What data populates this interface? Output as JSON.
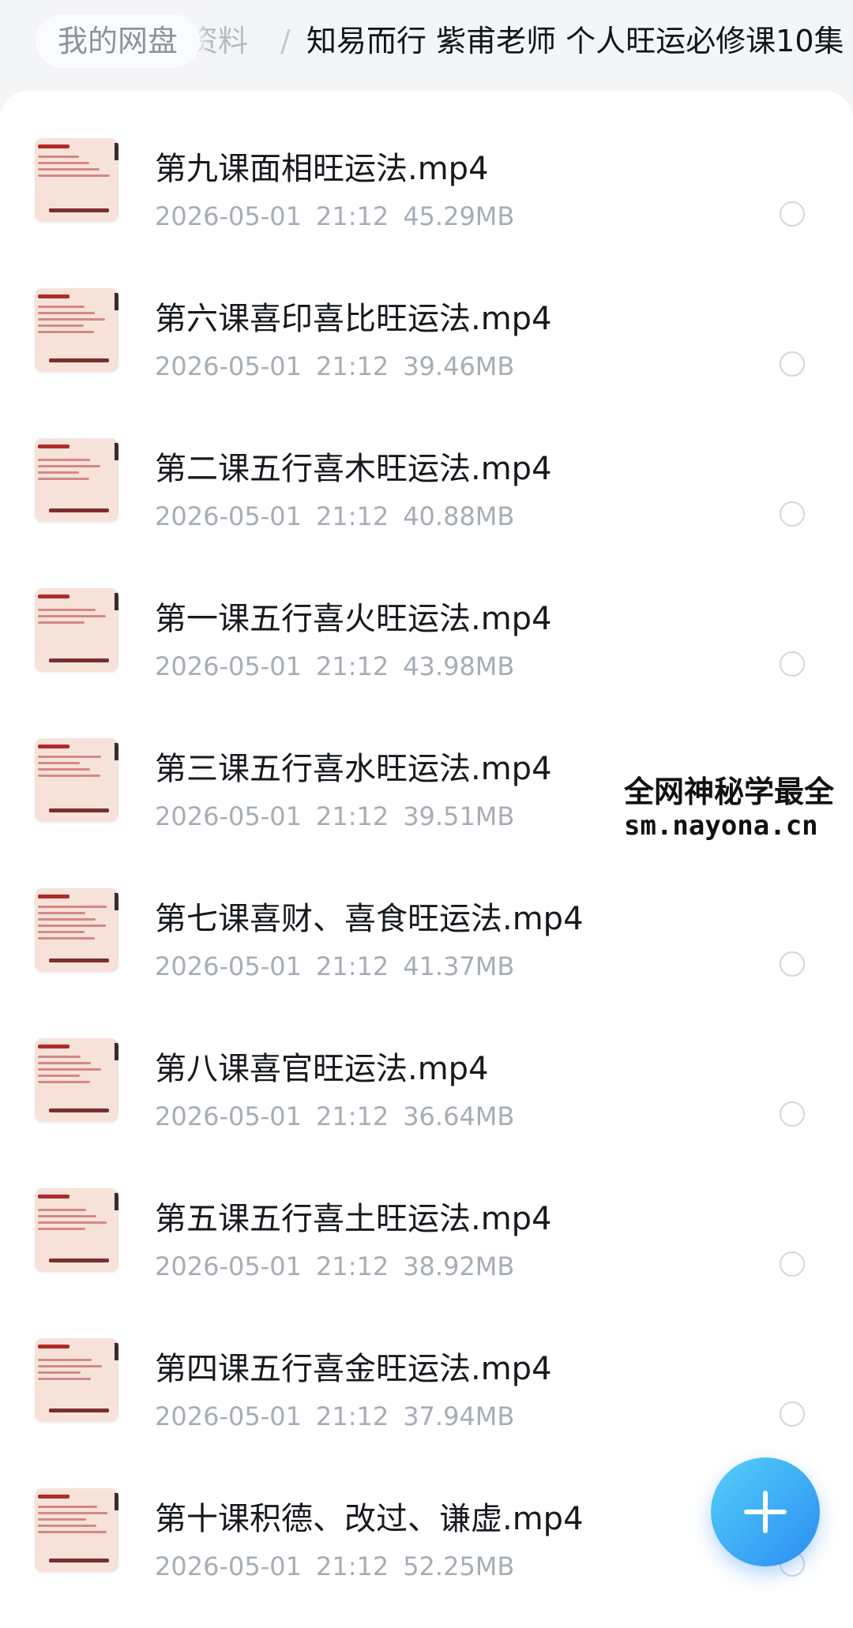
{
  "breadcrumb": {
    "root": "我的网盘",
    "middle": "资料",
    "separator": "/",
    "current": "知易而行 紫甫老师 个人旺运必修课10集"
  },
  "files": [
    {
      "name": "第九课面相旺运法.mp4",
      "date": "2026-05-01",
      "time": "21:12",
      "size": "45.29MB"
    },
    {
      "name": "第六课喜印喜比旺运法.mp4",
      "date": "2026-05-01",
      "time": "21:12",
      "size": "39.46MB"
    },
    {
      "name": "第二课五行喜木旺运法.mp4",
      "date": "2026-05-01",
      "time": "21:12",
      "size": "40.88MB"
    },
    {
      "name": "第一课五行喜火旺运法.mp4",
      "date": "2026-05-01",
      "time": "21:12",
      "size": "43.98MB"
    },
    {
      "name": "第三课五行喜水旺运法.mp4",
      "date": "2026-05-01",
      "time": "21:12",
      "size": "39.51MB"
    },
    {
      "name": "第七课喜财、喜食旺运法.mp4",
      "date": "2026-05-01",
      "time": "21:12",
      "size": "41.37MB"
    },
    {
      "name": "第八课喜官旺运法.mp4",
      "date": "2026-05-01",
      "time": "21:12",
      "size": "36.64MB"
    },
    {
      "name": "第五课五行喜土旺运法.mp4",
      "date": "2026-05-01",
      "time": "21:12",
      "size": "38.92MB"
    },
    {
      "name": "第四课五行喜金旺运法.mp4",
      "date": "2026-05-01",
      "time": "21:12",
      "size": "37.94MB"
    },
    {
      "name": "第十课积德、改过、谦虚.mp4",
      "date": "2026-05-01",
      "time": "21:12",
      "size": "52.25MB"
    }
  ],
  "watermark": {
    "line1": "全网神秘学最全",
    "line2": "sm.nayona.cn"
  },
  "icons": {
    "fab": "plus-icon",
    "checkbox": "radio-circle-icon",
    "thumbnail": "video-thumbnail"
  },
  "colors": {
    "accent": "#2a8cf2",
    "accent_light": "#55d0f8",
    "text_primary": "#16191d",
    "text_secondary": "#a7adb5",
    "thumb_bg": "#f6e2d9"
  }
}
